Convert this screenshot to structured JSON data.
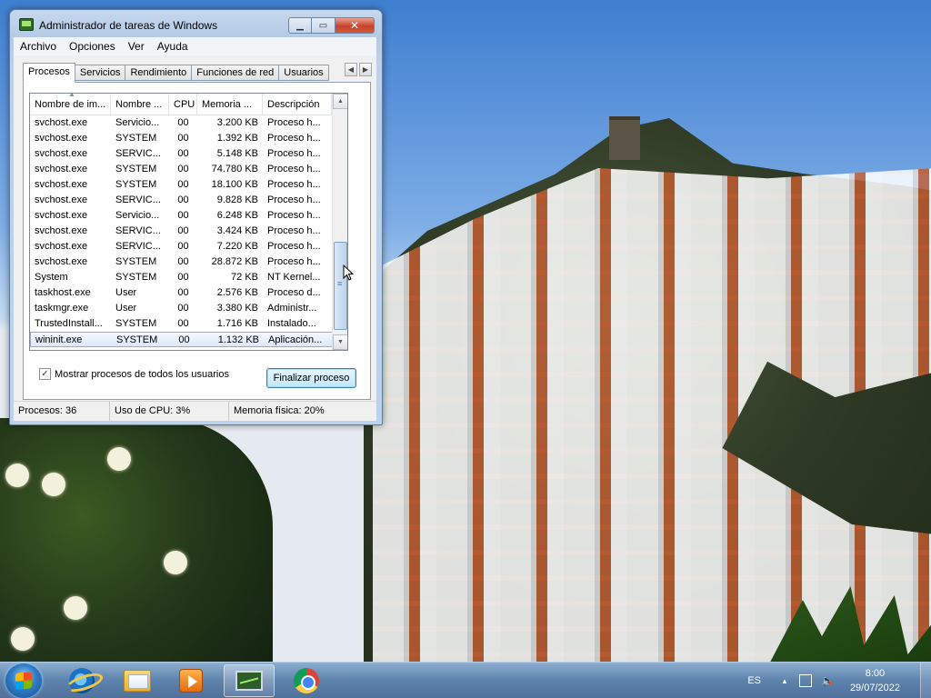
{
  "window": {
    "title": "Administrador de tareas de Windows",
    "controls": {
      "minimize": "▁",
      "maximize": "▭",
      "close": "✕"
    }
  },
  "menu": [
    "Archivo",
    "Opciones",
    "Ver",
    "Ayuda"
  ],
  "tabs": [
    "Procesos",
    "Servicios",
    "Rendimiento",
    "Funciones de red",
    "Usuarios"
  ],
  "active_tab": "Procesos",
  "process_table": {
    "columns": [
      "Nombre de im...",
      "Nombre ...",
      "CPU",
      "Memoria ...",
      "Descripción"
    ],
    "rows": [
      [
        "svchost.exe",
        "Servicio...",
        "00",
        "3.200 KB",
        "Proceso h..."
      ],
      [
        "svchost.exe",
        "SYSTEM",
        "00",
        "1.392 KB",
        "Proceso h..."
      ],
      [
        "svchost.exe",
        "SERVIC...",
        "00",
        "5.148 KB",
        "Proceso h..."
      ],
      [
        "svchost.exe",
        "SYSTEM",
        "00",
        "74.780 KB",
        "Proceso h..."
      ],
      [
        "svchost.exe",
        "SYSTEM",
        "00",
        "18.100 KB",
        "Proceso h..."
      ],
      [
        "svchost.exe",
        "SERVIC...",
        "00",
        "9.828 KB",
        "Proceso h..."
      ],
      [
        "svchost.exe",
        "Servicio...",
        "00",
        "6.248 KB",
        "Proceso h..."
      ],
      [
        "svchost.exe",
        "SERVIC...",
        "00",
        "3.424 KB",
        "Proceso h..."
      ],
      [
        "svchost.exe",
        "SERVIC...",
        "00",
        "7.220 KB",
        "Proceso h..."
      ],
      [
        "svchost.exe",
        "SYSTEM",
        "00",
        "28.872 KB",
        "Proceso h..."
      ],
      [
        "System",
        "SYSTEM",
        "00",
        "72 KB",
        "NT Kernel..."
      ],
      [
        "taskhost.exe",
        "User",
        "00",
        "2.576 KB",
        "Proceso d..."
      ],
      [
        "taskmgr.exe",
        "User",
        "00",
        "3.380 KB",
        "Administr..."
      ],
      [
        "TrustedInstall...",
        "SYSTEM",
        "00",
        "1.716 KB",
        "Instalado..."
      ],
      [
        "wininit.exe",
        "SYSTEM",
        "00",
        "1.132 KB",
        "Aplicación..."
      ]
    ],
    "selected_row": 14
  },
  "show_all_users": {
    "label": "Mostrar procesos de todos los usuarios",
    "checked": true
  },
  "end_process_button": "Finalizar proceso",
  "status": {
    "processes": "Procesos: 36",
    "cpu": "Uso de CPU: 3%",
    "memory": "Memoria física: 20%"
  },
  "taskbar": {
    "items": [
      "start-button",
      "internet-explorer",
      "windows-explorer",
      "media-player",
      "task-manager",
      "chrome"
    ],
    "active_item": "task-manager",
    "tray": {
      "language": "ES",
      "time": "8:00",
      "date": "29/07/2022"
    }
  }
}
